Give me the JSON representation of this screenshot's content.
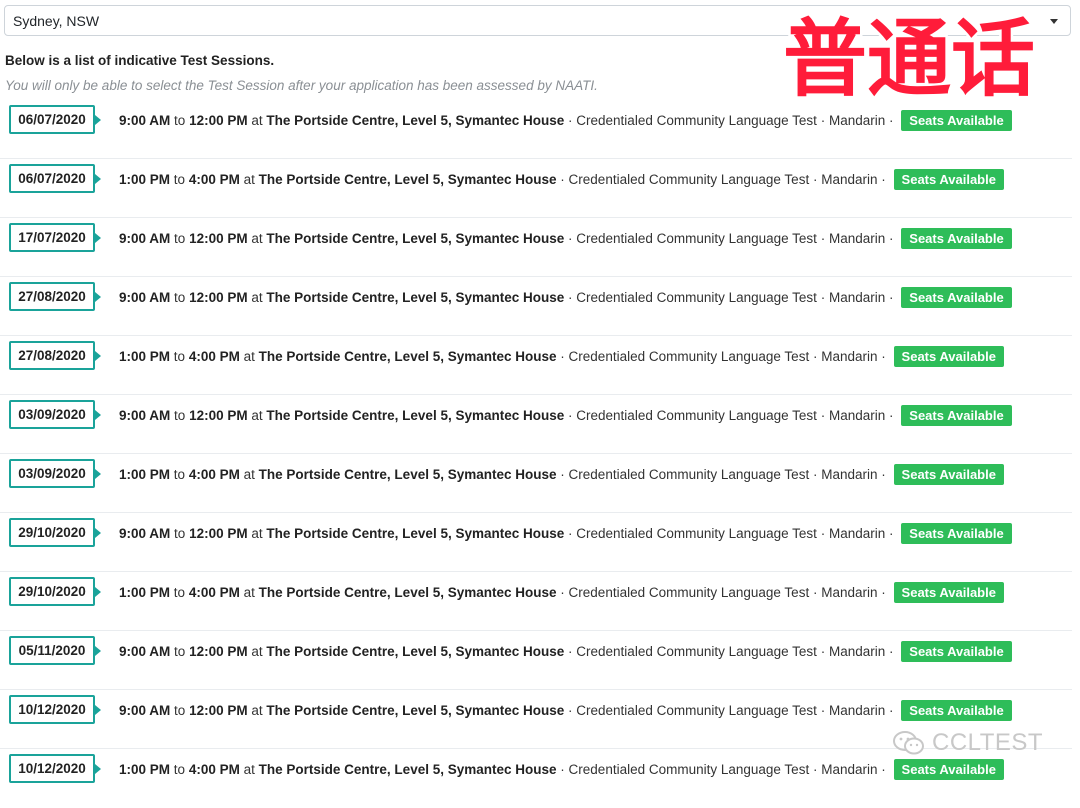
{
  "location": {
    "selected": "Sydney, NSW"
  },
  "intro": {
    "heading": "Below is a list of indicative Test Sessions.",
    "note": "You will only be able to select the Test Session after your application has been assessed by NAATI."
  },
  "watermark": {
    "chinese": "普通话",
    "brand": "CCLTEST"
  },
  "labels": {
    "to": "to",
    "at": "at",
    "sep": "·"
  },
  "sessions": [
    {
      "date": "06/07/2020",
      "start": "9:00 AM",
      "end": "12:00 PM",
      "venue": "The Portside Centre, Level 5, Symantec House",
      "test": "Credentialed Community Language Test",
      "language": "Mandarin",
      "status": "Seats Available"
    },
    {
      "date": "06/07/2020",
      "start": "1:00 PM",
      "end": "4:00 PM",
      "venue": "The Portside Centre, Level 5, Symantec House",
      "test": "Credentialed Community Language Test",
      "language": "Mandarin",
      "status": "Seats Available"
    },
    {
      "date": "17/07/2020",
      "start": "9:00 AM",
      "end": "12:00 PM",
      "venue": "The Portside Centre, Level 5, Symantec House",
      "test": "Credentialed Community Language Test",
      "language": "Mandarin",
      "status": "Seats Available"
    },
    {
      "date": "27/08/2020",
      "start": "9:00 AM",
      "end": "12:00 PM",
      "venue": "The Portside Centre, Level 5, Symantec House",
      "test": "Credentialed Community Language Test",
      "language": "Mandarin",
      "status": "Seats Available"
    },
    {
      "date": "27/08/2020",
      "start": "1:00 PM",
      "end": "4:00 PM",
      "venue": "The Portside Centre, Level 5, Symantec House",
      "test": "Credentialed Community Language Test",
      "language": "Mandarin",
      "status": "Seats Available"
    },
    {
      "date": "03/09/2020",
      "start": "9:00 AM",
      "end": "12:00 PM",
      "venue": "The Portside Centre, Level 5, Symantec House",
      "test": "Credentialed Community Language Test",
      "language": "Mandarin",
      "status": "Seats Available"
    },
    {
      "date": "03/09/2020",
      "start": "1:00 PM",
      "end": "4:00 PM",
      "venue": "The Portside Centre, Level 5, Symantec House",
      "test": "Credentialed Community Language Test",
      "language": "Mandarin",
      "status": "Seats Available"
    },
    {
      "date": "29/10/2020",
      "start": "9:00 AM",
      "end": "12:00 PM",
      "venue": "The Portside Centre, Level 5, Symantec House",
      "test": "Credentialed Community Language Test",
      "language": "Mandarin",
      "status": "Seats Available"
    },
    {
      "date": "29/10/2020",
      "start": "1:00 PM",
      "end": "4:00 PM",
      "venue": "The Portside Centre, Level 5, Symantec House",
      "test": "Credentialed Community Language Test",
      "language": "Mandarin",
      "status": "Seats Available"
    },
    {
      "date": "05/11/2020",
      "start": "9:00 AM",
      "end": "12:00 PM",
      "venue": "The Portside Centre, Level 5, Symantec House",
      "test": "Credentialed Community Language Test",
      "language": "Mandarin",
      "status": "Seats Available"
    },
    {
      "date": "10/12/2020",
      "start": "9:00 AM",
      "end": "12:00 PM",
      "venue": "The Portside Centre, Level 5, Symantec House",
      "test": "Credentialed Community Language Test",
      "language": "Mandarin",
      "status": "Seats Available"
    },
    {
      "date": "10/12/2020",
      "start": "1:00 PM",
      "end": "4:00 PM",
      "venue": "The Portside Centre, Level 5, Symantec House",
      "test": "Credentialed Community Language Test",
      "language": "Mandarin",
      "status": "Seats Available"
    }
  ],
  "colors": {
    "date_border": "#1aa39a",
    "badge_bg": "#2ebd59",
    "watermark_red": "#ff1c3a"
  },
  "icons": {
    "select_caret": "chevron-down-icon",
    "wechat": "wechat-icon"
  }
}
